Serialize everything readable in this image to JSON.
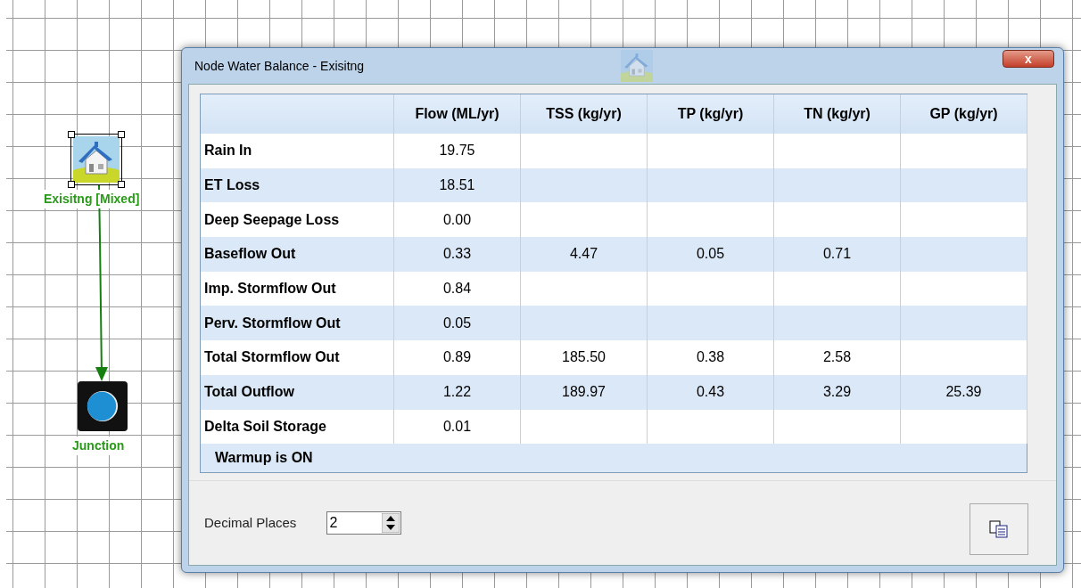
{
  "canvas": {
    "nodes": [
      {
        "kind": "catchment",
        "label": "Exisitng [Mixed]",
        "selected": true
      },
      {
        "kind": "junction",
        "label": "Junction",
        "selected": false
      }
    ]
  },
  "dialog": {
    "title": "Node Water Balance - Exisitng",
    "close": "x",
    "table": {
      "columns": [
        "Flow (ML/yr)",
        "TSS (kg/yr)",
        "TP (kg/yr)",
        "TN (kg/yr)",
        "GP (kg/yr)"
      ],
      "rows": [
        {
          "label": "Rain In",
          "cells": [
            "19.75",
            null,
            null,
            null,
            null
          ]
        },
        {
          "label": "ET Loss",
          "cells": [
            "18.51",
            null,
            null,
            null,
            null
          ]
        },
        {
          "label": "Deep Seepage Loss",
          "cells": [
            "0.00",
            null,
            null,
            null,
            null
          ]
        },
        {
          "label": "Baseflow Out",
          "cells": [
            "0.33",
            "4.47",
            "0.05",
            "0.71",
            null
          ]
        },
        {
          "label": "Imp. Stormflow Out",
          "cells": [
            "0.84",
            null,
            null,
            null,
            null
          ]
        },
        {
          "label": "Perv. Stormflow Out",
          "cells": [
            "0.05",
            null,
            null,
            null,
            null
          ]
        },
        {
          "label": "Total Stormflow Out",
          "cells": [
            "0.89",
            "185.50",
            "0.38",
            "2.58",
            null
          ]
        },
        {
          "label": "Total Outflow",
          "cells": [
            "1.22",
            "189.97",
            "0.43",
            "3.29",
            "25.39"
          ]
        },
        {
          "label": "Delta Soil Storage",
          "cells": [
            "0.01",
            null,
            null,
            null,
            null
          ]
        }
      ],
      "note": "Warmup is ON"
    },
    "decimal_places": {
      "label": "Decimal Places",
      "value": "2"
    }
  }
}
